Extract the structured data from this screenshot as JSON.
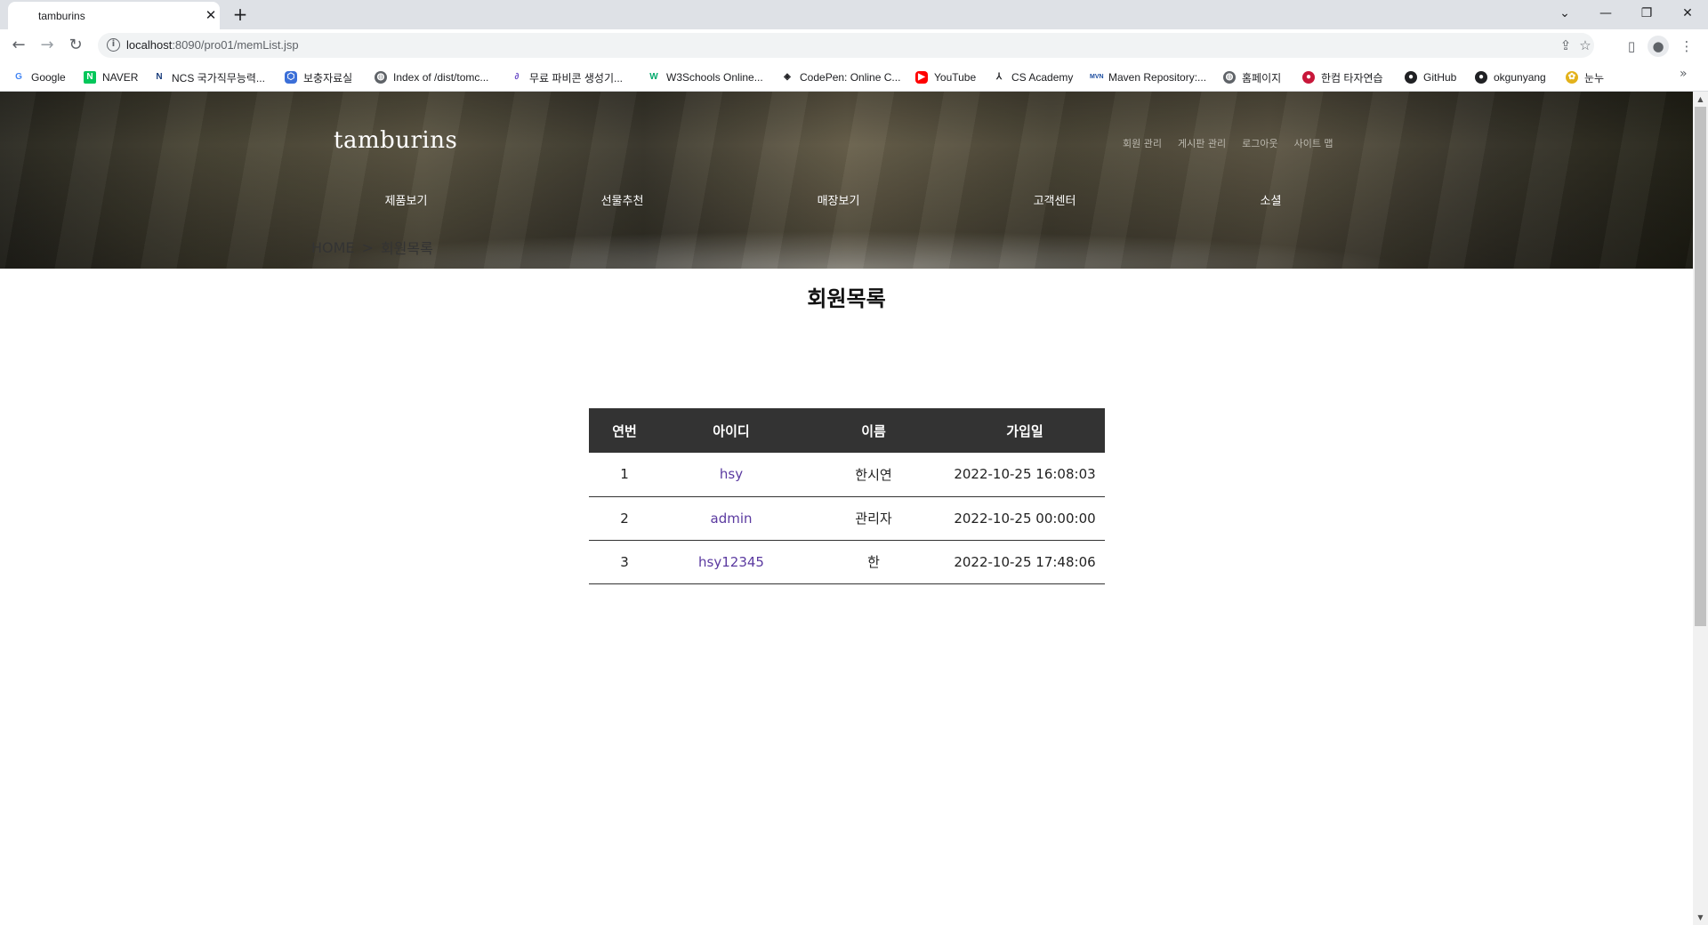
{
  "browser": {
    "tab_title": "tamburins",
    "tab_close": "✕",
    "new_tab": "+",
    "window_controls": {
      "dropdown": "⌄",
      "minimize": "—",
      "restore": "❐",
      "close": "✕"
    },
    "url_host": "localhost",
    "url_rest": ":8090/pro01/memList.jsp",
    "bookmarks": [
      {
        "label": "Google",
        "icon": "google-icon",
        "color": "#4285f4"
      },
      {
        "label": "NAVER",
        "icon": "naver-icon",
        "color": "#03c75a"
      },
      {
        "label": "NCS 국가직무능력...",
        "icon": "ncs-icon",
        "color": "#1a3d7c"
      },
      {
        "label": "보충자료실",
        "icon": "hexagon-icon",
        "color": "#3b6fd8"
      },
      {
        "label": "Index of /dist/tomc...",
        "icon": "globe-icon",
        "color": "#5f6368"
      },
      {
        "label": "무료 파비콘 생성기...",
        "icon": "favicon-icon",
        "color": "#6a4cc7"
      },
      {
        "label": "W3Schools Online...",
        "icon": "w3schools-icon",
        "color": "#04aa6d"
      },
      {
        "label": "CodePen: Online C...",
        "icon": "codepen-icon",
        "color": "#202124"
      },
      {
        "label": "YouTube",
        "icon": "youtube-icon",
        "color": "#ff0000"
      },
      {
        "label": "CS Academy",
        "icon": "cs-academy-icon",
        "color": "#202124"
      },
      {
        "label": "Maven Repository:...",
        "icon": "maven-icon",
        "color": "#1d4ea0"
      },
      {
        "label": "홈페이지",
        "icon": "globe-icon",
        "color": "#5f6368"
      },
      {
        "label": "한컴 타자연습",
        "icon": "hancom-icon",
        "color": "#c8173a"
      },
      {
        "label": "GitHub",
        "icon": "github-icon",
        "color": "#202124"
      },
      {
        "label": "okgunyang",
        "icon": "github-icon",
        "color": "#202124"
      },
      {
        "label": "눈누",
        "icon": "noonnu-icon",
        "color": "#e3b21b"
      }
    ],
    "bookmarks_more": "»"
  },
  "site": {
    "logo": "tamburins",
    "util_links": [
      "회원 관리",
      "게시판 관리",
      "로그아웃",
      "사이트 맵"
    ],
    "nav": [
      "제품보기",
      "선물추천",
      "매장보기",
      "고객센터",
      "소셜"
    ],
    "breadcrumb": {
      "home": "HOME",
      "sep": ">",
      "current": "회원목록"
    },
    "title": "회원목록",
    "table": {
      "headers": [
        "연번",
        "아이디",
        "이름",
        "가입일"
      ],
      "rows": [
        [
          "1",
          "hsy",
          "한시연",
          "2022-10-25 16:08:03"
        ],
        [
          "2",
          "admin",
          "관리자",
          "2022-10-25 00:00:00"
        ],
        [
          "3",
          "hsy12345",
          "한",
          "2022-10-25 17:48:06"
        ]
      ]
    }
  },
  "colors": {
    "table_header_bg": "#333333",
    "id_link": "#5b3aa0"
  }
}
